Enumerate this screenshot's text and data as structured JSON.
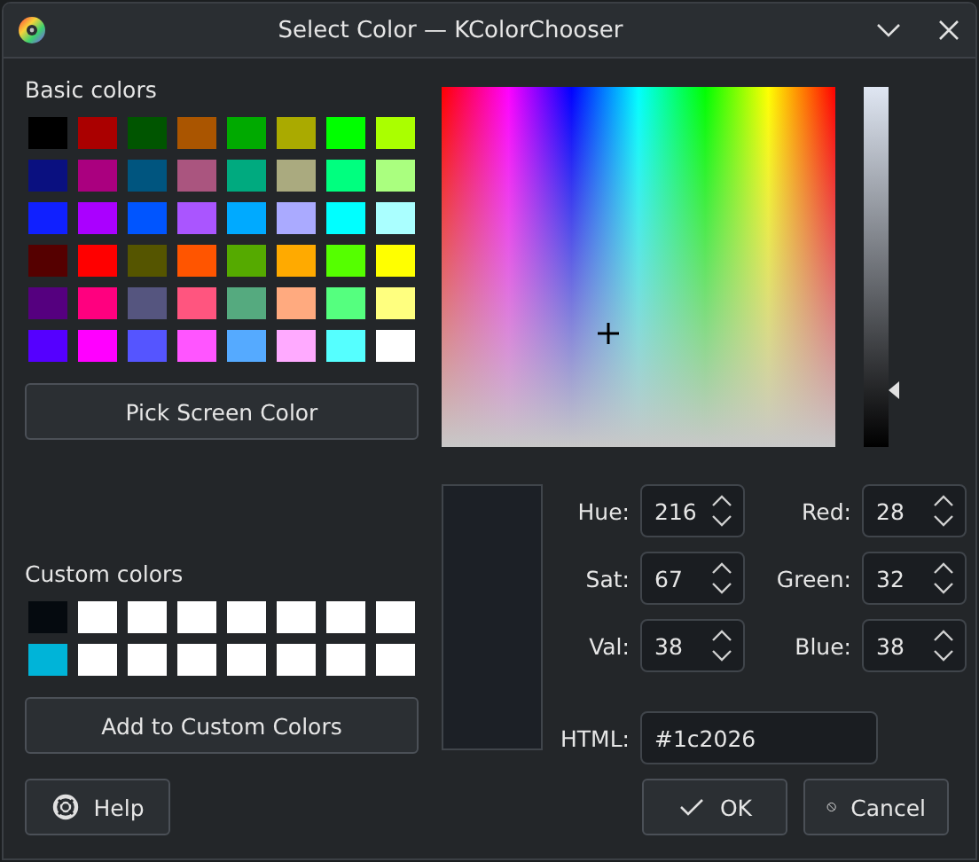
{
  "window": {
    "title": "Select Color — KColorChooser"
  },
  "basic_colors": {
    "label": "Basic colors",
    "swatches": [
      {
        "color": "#000000"
      },
      {
        "color": "#aa0000"
      },
      {
        "color": "#005500"
      },
      {
        "color": "#aa5500"
      },
      {
        "color": "#00aa00"
      },
      {
        "color": "#aaaa00"
      },
      {
        "color": "#00ff00"
      },
      {
        "color": "#aaff00"
      },
      {
        "color": "#0a1080"
      },
      {
        "color": "#aa007f"
      },
      {
        "color": "#00557f"
      },
      {
        "color": "#aa557f"
      },
      {
        "color": "#00aa7f"
      },
      {
        "color": "#aaaa7f"
      },
      {
        "color": "#00ff7f"
      },
      {
        "color": "#aaff7f"
      },
      {
        "color": "#1020ff"
      },
      {
        "color": "#aa00ff"
      },
      {
        "color": "#0055ff"
      },
      {
        "color": "#aa55ff"
      },
      {
        "color": "#00aaff"
      },
      {
        "color": "#aaaaff"
      },
      {
        "color": "#00ffff"
      },
      {
        "color": "#aaffff"
      },
      {
        "color": "#550000"
      },
      {
        "color": "#ff0000"
      },
      {
        "color": "#555500"
      },
      {
        "color": "#ff5500"
      },
      {
        "color": "#55aa00"
      },
      {
        "color": "#ffaa00"
      },
      {
        "color": "#55ff00"
      },
      {
        "color": "#ffff00"
      },
      {
        "color": "#55007f"
      },
      {
        "color": "#ff007f"
      },
      {
        "color": "#55557f"
      },
      {
        "color": "#ff557f"
      },
      {
        "color": "#55aa7f"
      },
      {
        "color": "#ffaa7f"
      },
      {
        "color": "#55ff7f"
      },
      {
        "color": "#ffff7f"
      },
      {
        "color": "#5500ff"
      },
      {
        "color": "#ff00ff"
      },
      {
        "color": "#5555ff"
      },
      {
        "color": "#ff55ff"
      },
      {
        "color": "#55aaff"
      },
      {
        "color": "#ffaaff"
      },
      {
        "color": "#55ffff"
      },
      {
        "color": "#ffffff"
      }
    ]
  },
  "pick_button": "Pick Screen Color",
  "value_slider": {
    "level": 0.16
  },
  "preview": {
    "color": "#1c2026"
  },
  "fields": [
    {
      "label": "Hue:",
      "value": "216"
    },
    {
      "label": "Red:",
      "value": "28"
    },
    {
      "label": "Sat:",
      "value": "67"
    },
    {
      "label": "Green:",
      "value": "32"
    },
    {
      "label": "Val:",
      "value": "38"
    },
    {
      "label": "Blue:",
      "value": "38"
    }
  ],
  "html": {
    "label": "HTML:",
    "value": "#1c2026"
  },
  "custom_colors": {
    "label": "Custom colors",
    "swatches": [
      {
        "color": "#050a0f"
      },
      {
        "color": "#ffffff"
      },
      {
        "color": "#ffffff"
      },
      {
        "color": "#ffffff"
      },
      {
        "color": "#ffffff"
      },
      {
        "color": "#ffffff"
      },
      {
        "color": "#ffffff"
      },
      {
        "color": "#ffffff"
      },
      {
        "color": "#00b4d8"
      },
      {
        "color": "#ffffff"
      },
      {
        "color": "#ffffff"
      },
      {
        "color": "#ffffff"
      },
      {
        "color": "#ffffff"
      },
      {
        "color": "#ffffff"
      },
      {
        "color": "#ffffff"
      },
      {
        "color": "#ffffff"
      }
    ]
  },
  "add_button": "Add to Custom Colors",
  "buttons": [
    {
      "label": "Help",
      "kind": "help"
    },
    {
      "label": "OK",
      "kind": "ok"
    },
    {
      "label": "Cancel",
      "kind": "cancel"
    }
  ]
}
